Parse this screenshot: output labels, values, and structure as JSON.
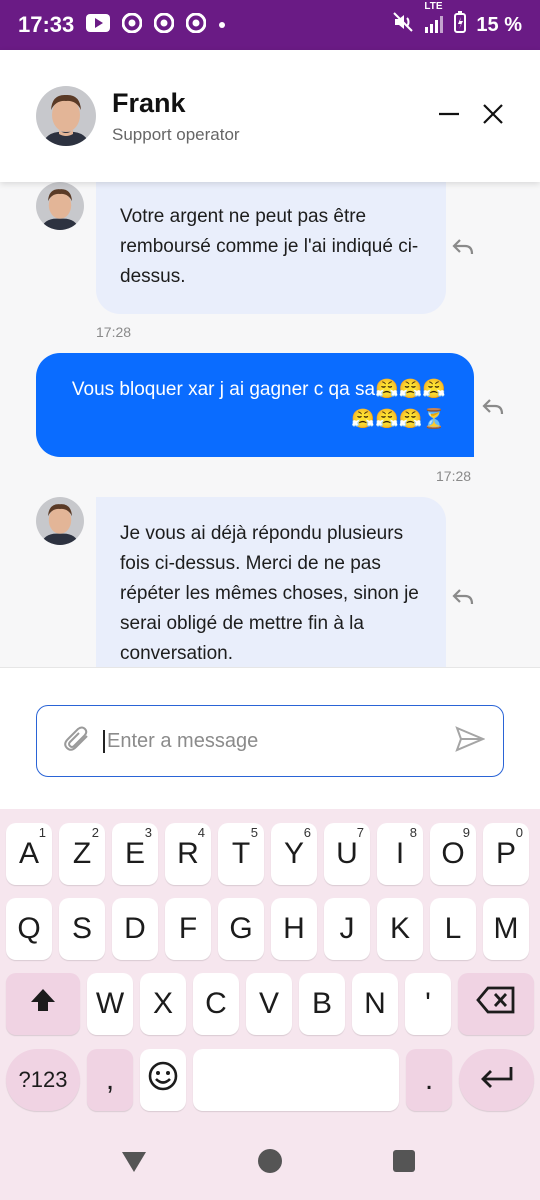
{
  "status": {
    "time": "17:33",
    "network": "LTE",
    "battery": "15 %",
    "icons": [
      "youtube-icon",
      "chrome-icon",
      "chrome-icon",
      "chrome-icon",
      "dot-icon",
      "mute-icon",
      "signal-icon",
      "battery-icon"
    ]
  },
  "header": {
    "name": "Frank",
    "role": "Support operator"
  },
  "messages": [
    {
      "direction": "in",
      "text": "Votre argent ne peut pas être remboursé comme je l'ai indiqué ci-dessus.",
      "time": "17:28"
    },
    {
      "direction": "out",
      "text": "Vous bloquer xar j ai gagner c qa sa😤😤😤😤😤😤⏳",
      "time": "17:28"
    },
    {
      "direction": "in",
      "text": "Je vous ai déjà répondu plusieurs fois ci-dessus. Merci de ne pas répéter les mêmes choses, sinon je serai obligé de mettre fin à la conversation.",
      "time": ""
    }
  ],
  "input": {
    "placeholder": "Enter a message"
  },
  "keyboard": {
    "row1": [
      {
        "k": "A",
        "sup": "1"
      },
      {
        "k": "Z",
        "sup": "2"
      },
      {
        "k": "E",
        "sup": "3"
      },
      {
        "k": "R",
        "sup": "4"
      },
      {
        "k": "T",
        "sup": "5"
      },
      {
        "k": "Y",
        "sup": "6"
      },
      {
        "k": "U",
        "sup": "7"
      },
      {
        "k": "I",
        "sup": "8"
      },
      {
        "k": "O",
        "sup": "9"
      },
      {
        "k": "P",
        "sup": "0"
      }
    ],
    "row2": [
      "Q",
      "S",
      "D",
      "F",
      "G",
      "H",
      "J",
      "K",
      "L",
      "M"
    ],
    "row3": [
      "W",
      "X",
      "C",
      "V",
      "B",
      "N",
      "'"
    ],
    "symbols_label": "?123",
    "comma": ",",
    "period": "."
  },
  "colors": {
    "status_bar": "#6a1b85",
    "outgoing_bubble": "#0a6cff",
    "incoming_bubble": "#e9eefb",
    "keyboard_bg": "#f6e6ee"
  }
}
